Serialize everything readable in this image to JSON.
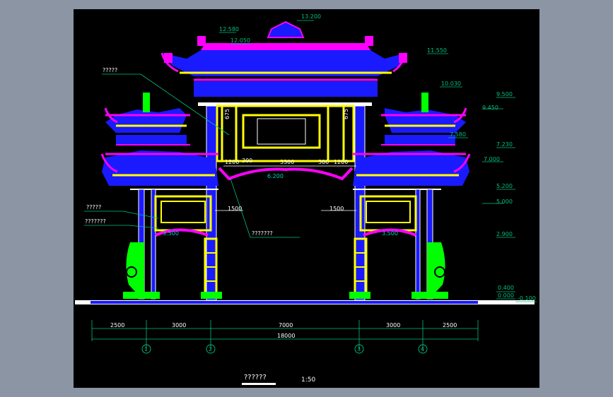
{
  "colors": {
    "background": "#000000",
    "frame": "#8c95a4",
    "roof_blue": "#1a1aff",
    "accent_magenta": "#ff00ff",
    "accent_yellow": "#ffff00",
    "accent_green": "#00ff00",
    "line_white": "#ffffff",
    "dim_green": "#00c080",
    "dim_cyan": "#00d0c0"
  },
  "elevations": {
    "top": "13.200",
    "e12580": "12.580",
    "e12050": "12.050",
    "e11550": "11.550",
    "e10030": "10.030",
    "e9500": "9.500",
    "e9450": "9.450",
    "e7580": "7.580",
    "e7230": "7.230",
    "e7000": "7.000",
    "e5200": "5.200",
    "e5000": "5.000",
    "e2900": "2.900",
    "e0400": "0.400",
    "e0000": "0.000",
    "e_neg0100": "-0.100"
  },
  "center_dims": {
    "d1200_left": "1200",
    "d300_left": "300",
    "d3300": "3300",
    "d300_right": "300",
    "d1200_right": "1200",
    "d6200": "6.200",
    "d1500_left": "1500",
    "d1500_right": "1500",
    "d3500_left": "3.500",
    "d3500_right": "3.500",
    "d675_left": "675",
    "d675_right": "675"
  },
  "bottom_dims": {
    "d2500_left": "2500",
    "d3000_left": "3000",
    "d7000": "7000",
    "d3000_right": "3000",
    "d2500_right": "2500",
    "total": "18000"
  },
  "axes": [
    "1",
    "2",
    "3",
    "4"
  ],
  "annotations": {
    "label_a": "?????",
    "label_b": "?????",
    "label_c": "???????",
    "label_d": "???????"
  },
  "title": {
    "name": "??????",
    "scale": "1:50"
  }
}
